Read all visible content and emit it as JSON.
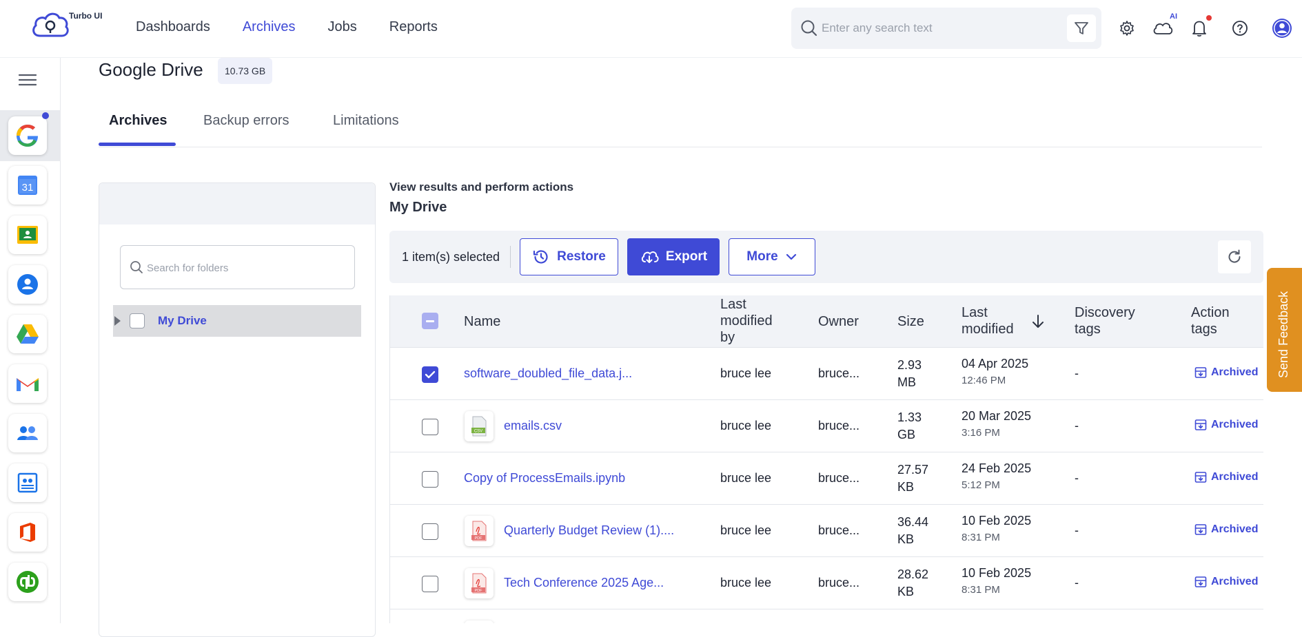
{
  "app": {
    "brand_name": "Turbo UI",
    "nav": [
      {
        "label": "Dashboards",
        "active": false
      },
      {
        "label": "Archives",
        "active": true
      },
      {
        "label": "Jobs",
        "active": false
      },
      {
        "label": "Reports",
        "active": false
      }
    ],
    "search": {
      "placeholder": "Enter any search text",
      "value": ""
    },
    "ai_badge": "AI",
    "icons": [
      "search-icon",
      "filter-icon",
      "gear-icon",
      "ai-cloud-icon",
      "bell-icon",
      "help-icon",
      "user-avatar-icon"
    ]
  },
  "sidebar": {
    "apps": [
      "google-workspace",
      "google-calendar",
      "google-classroom",
      "contacts",
      "google-drive",
      "gmail",
      "groups",
      "directory",
      "office-365",
      "quickbooks"
    ],
    "calendar_label": "31"
  },
  "page": {
    "title": "Google Drive",
    "size_badge": "10.73 GB",
    "tabs": [
      {
        "label": "Archives",
        "active": true
      },
      {
        "label": "Backup errors",
        "active": false
      },
      {
        "label": "Limitations",
        "active": false
      }
    ]
  },
  "folders": {
    "search_placeholder": "Search for folders",
    "items": [
      {
        "label": "My Drive",
        "selected": true
      }
    ]
  },
  "results": {
    "subtitle": "View results and perform actions",
    "title": "My Drive",
    "selected_text": "1 item(s) selected",
    "restore_label": "Restore",
    "export_label": "Export",
    "more_label": "More"
  },
  "table": {
    "columns": {
      "name": "Name",
      "last_modified_by_1": "Last",
      "last_modified_by_2": "modified",
      "last_modified_by_3": "by",
      "owner": "Owner",
      "size": "Size",
      "last_modified_1": "Last",
      "last_modified_2": "modified",
      "discovery_1": "Discovery",
      "discovery_2": "tags",
      "action_1": "Action",
      "action_2": "tags"
    },
    "rows": [
      {
        "checked": true,
        "icon": null,
        "name": "software_doubled_file_data.j...",
        "modified_by": "bruce lee",
        "owner": "bruce...",
        "size_1": "2.93",
        "size_2": "MB",
        "date": "04 Apr 2025",
        "time": "12:46 PM",
        "discovery": "-",
        "action": "Archived"
      },
      {
        "checked": false,
        "icon": "csv",
        "name": "emails.csv",
        "modified_by": "bruce lee",
        "owner": "bruce...",
        "size_1": "1.33",
        "size_2": "GB",
        "date": "20 Mar 2025",
        "time": "3:16 PM",
        "discovery": "-",
        "action": "Archived"
      },
      {
        "checked": false,
        "icon": null,
        "name": "Copy of ProcessEmails.ipynb",
        "modified_by": "bruce lee",
        "owner": "bruce...",
        "size_1": "27.57",
        "size_2": "KB",
        "date": "24 Feb 2025",
        "time": "5:12 PM",
        "discovery": "-",
        "action": "Archived"
      },
      {
        "checked": false,
        "icon": "pdf",
        "name": "Quarterly Budget Review (1)....",
        "modified_by": "bruce lee",
        "owner": "bruce...",
        "size_1": "36.44",
        "size_2": "KB",
        "date": "10 Feb 2025",
        "time": "8:31 PM",
        "discovery": "-",
        "action": "Archived"
      },
      {
        "checked": false,
        "icon": "pdf",
        "name": "Tech Conference 2025 Age...",
        "modified_by": "bruce lee",
        "owner": "bruce...",
        "size_1": "28.62",
        "size_2": "KB",
        "date": "10 Feb 2025",
        "time": "8:31 PM",
        "discovery": "-",
        "action": "Archived"
      }
    ]
  },
  "feedback_label": "Send Feedback",
  "colors": {
    "accent": "#3f4ad6",
    "feedback": "#e09020"
  }
}
